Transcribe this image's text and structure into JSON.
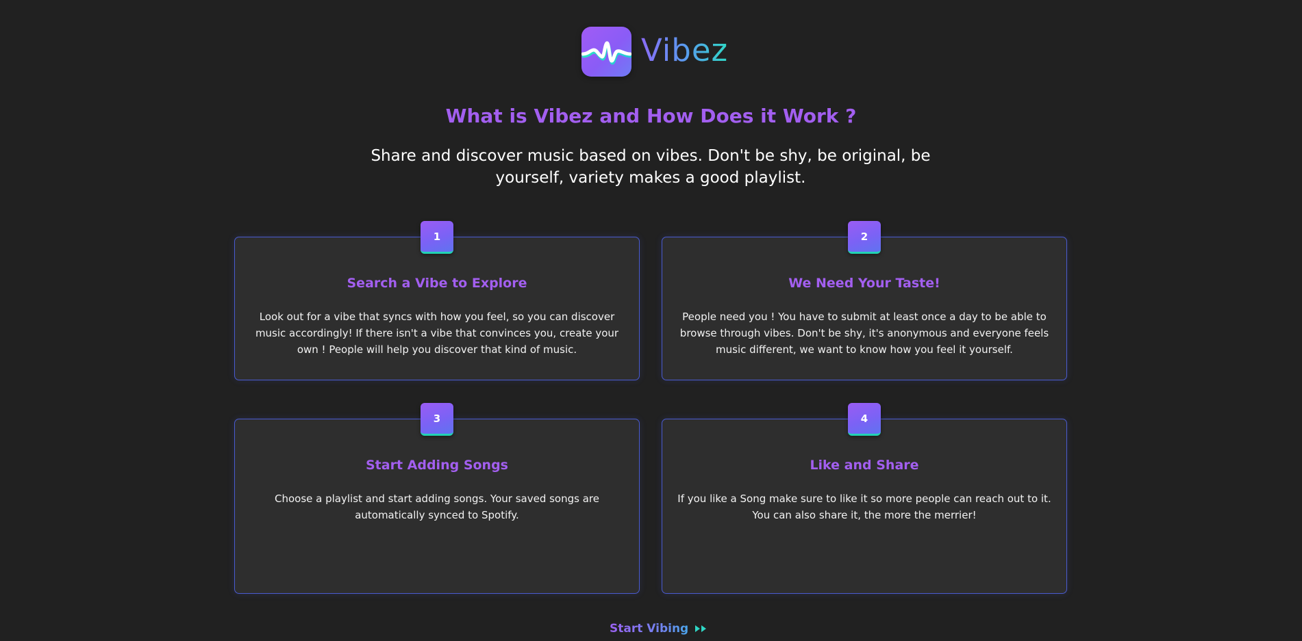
{
  "brand": {
    "name": "Vibez",
    "logo_icon": "soundwave-icon"
  },
  "intro": {
    "title": "What is Vibez and How Does it Work ?",
    "subtitle": "Share and discover music based on vibes. Don't be shy, be original, be yourself, variety makes a good playlist."
  },
  "steps": [
    {
      "number": "1",
      "title": "Search a Vibe to Explore",
      "text": "Look out for a vibe that syncs with how you feel, so you can discover music accordingly! If there isn't a vibe that convinces you, create your own ! People will help you discover that kind of music."
    },
    {
      "number": "2",
      "title": "We Need Your Taste!",
      "text": "People need you ! You have to submit at least once a day to be able to browse through vibes. Don't be shy, it's anonymous and everyone feels music different, we want to know how you feel it yourself."
    },
    {
      "number": "3",
      "title": "Start Adding Songs",
      "text": "Choose a playlist and start adding songs. Your saved songs are automatically synced to Spotify."
    },
    {
      "number": "4",
      "title": "Like and Share",
      "text": "If you like a Song make sure to like it so more people can reach out to it. You can also share it, the more the merrier!"
    }
  ],
  "cta": {
    "label": "Start Vibing",
    "icon": "fast-forward-icon"
  },
  "colors": {
    "background": "#212121",
    "card_background": "#2e2e2e",
    "card_border": "#4a5bd0",
    "accent_purple": "#a35ff0",
    "accent_teal": "#22d3b4"
  }
}
